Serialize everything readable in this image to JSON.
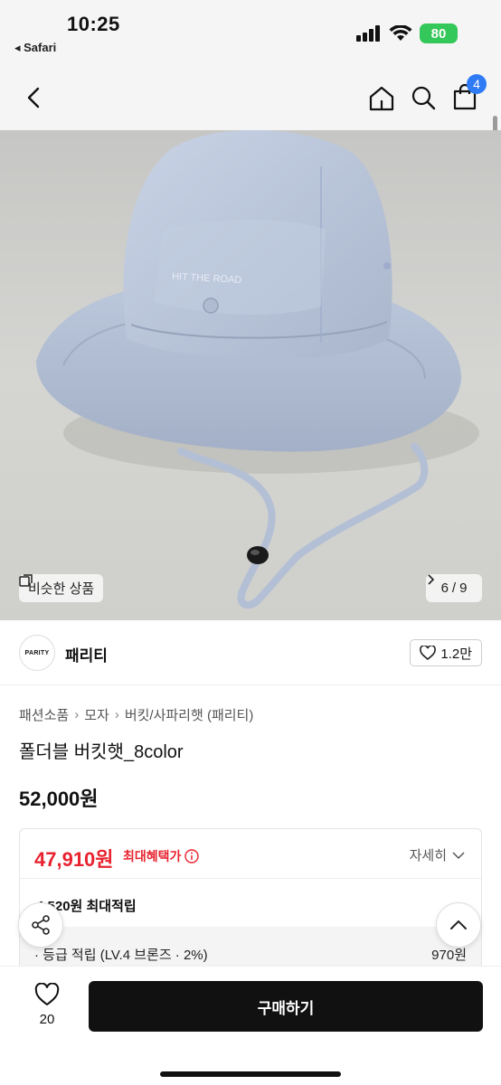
{
  "status_bar": {
    "time": "10:25",
    "back_label": "◂ Safari",
    "battery": "80"
  },
  "nav": {
    "cart_count": "4"
  },
  "gallery": {
    "similar_label": "비슷한 상품",
    "current": "6",
    "separator": "/",
    "total": "9",
    "hat_print": "HIT THE ROAD"
  },
  "brand": {
    "logo_text": "PARITY",
    "name": "패리티",
    "likes": "1.2만"
  },
  "breadcrumb": [
    "패션소품",
    "모자",
    "버킷/사파리햇 (패리티)"
  ],
  "product": {
    "name": "폴더블 버킷햇_8color",
    "price": "52,000원"
  },
  "benefit": {
    "sale_price": "47,910원",
    "max_benefit_label": "최대혜택가",
    "detail_label": "자세히",
    "points_title": "4,520원 최대적립",
    "grade_label": "· 등급 적립 (LV.4 브론즈 · 2%)",
    "grade_value": "970원"
  },
  "bottom": {
    "wish_count": "20",
    "buy_label": "구매하기"
  },
  "colors": {
    "accent_red": "#e8232f",
    "badge_blue": "#2f7bf5",
    "battery_green": "#34c759",
    "hat_blue": "#b9c6dc"
  }
}
